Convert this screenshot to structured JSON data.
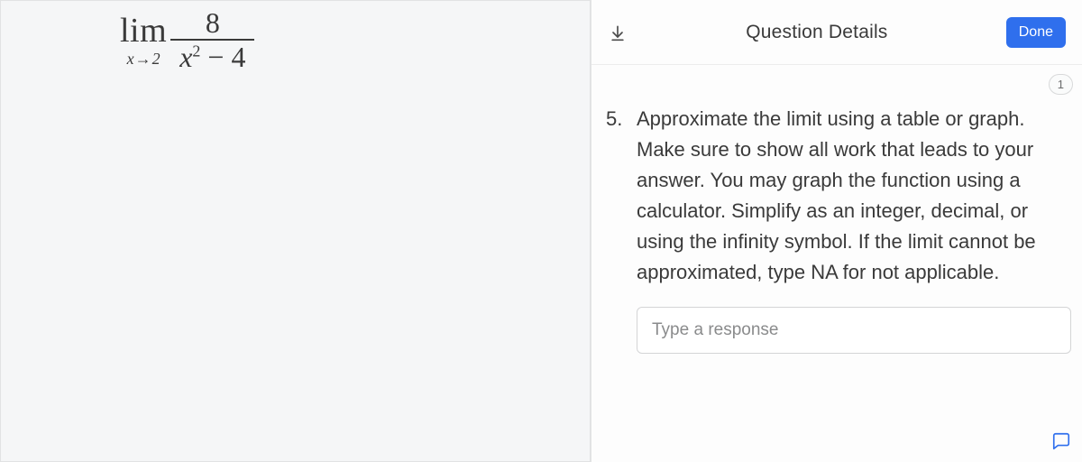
{
  "math": {
    "lim_label": "lim",
    "approach_var": "x",
    "approach_arrow": "→",
    "approach_val": "2",
    "numerator": "8",
    "denom_x": "x",
    "denom_exp": "2",
    "denom_tail": " − 4"
  },
  "header": {
    "title": "Question Details",
    "done_label": "Done"
  },
  "points": "1",
  "question": {
    "number": "5.",
    "text": "Approximate the limit using a table or graph. Make sure to show all work that leads to your answer. You may graph the function using a calculator. Simplify as an integer, decimal, or using the infinity symbol. If the limit cannot be approximated, type NA for not applicable."
  },
  "response": {
    "placeholder": "Type a response"
  }
}
